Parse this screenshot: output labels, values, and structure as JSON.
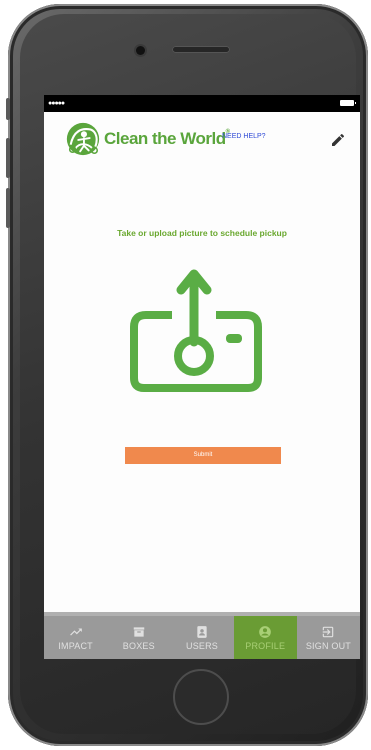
{
  "status_bar": {
    "signal": "●●●●●"
  },
  "header": {
    "brand": "Clean the World",
    "trademark": "®",
    "help_link": "NEED HELP?"
  },
  "main": {
    "prompt": "Take or upload picture to schedule pickup",
    "submit_label": "Submit"
  },
  "tabs": [
    {
      "label": "IMPACT",
      "icon": "trending-up-icon"
    },
    {
      "label": "BOXES",
      "icon": "archive-box-icon"
    },
    {
      "label": "USERS",
      "icon": "contact-book-icon"
    },
    {
      "label": "PROFILE",
      "icon": "account-circle-icon",
      "active": true
    },
    {
      "label": "SIGN OUT",
      "icon": "exit-icon"
    }
  ],
  "colors": {
    "brand_green": "#5aa53c",
    "icon_green": "#5aad45",
    "submit_orange": "#f0894d",
    "tabbar_gray": "#9a9a9a",
    "tab_active_green": "#6a9c34",
    "help_link_blue": "#2e49d6"
  }
}
